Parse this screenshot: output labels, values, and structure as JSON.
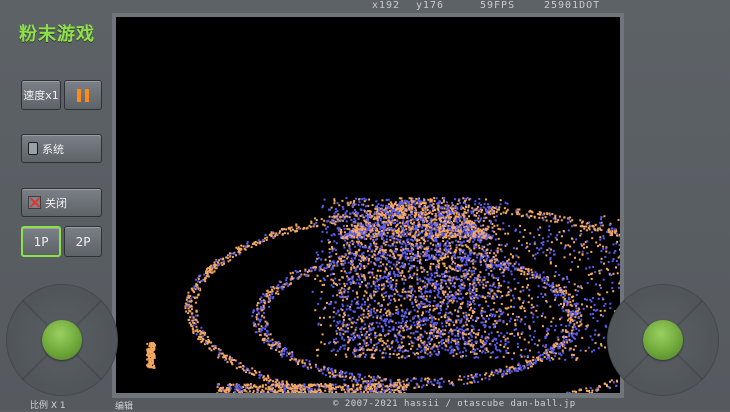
{
  "app": {
    "title": "粉末游戏"
  },
  "controls": {
    "speed_label": "速度x1",
    "system_label": "系统",
    "close_label": "关闭",
    "player1_label": "1P",
    "player2_label": "2P"
  },
  "stats": {
    "x": "x192",
    "y": "y176",
    "fps": "59FPS",
    "dots": "25901DOT"
  },
  "footer": {
    "scale": "比例 X 1",
    "edit": "编辑",
    "copyright": "© 2007-2021 hassii / otascube dan-ball.jp"
  },
  "colors": {
    "accent": "#8de04a",
    "pause": "#ff8a1c",
    "powder_orange": "#f5a860",
    "powder_blue": "#5a5cf0"
  },
  "icons": {
    "pause": "pause-icon",
    "system": "tablet-icon",
    "close": "x-icon"
  }
}
